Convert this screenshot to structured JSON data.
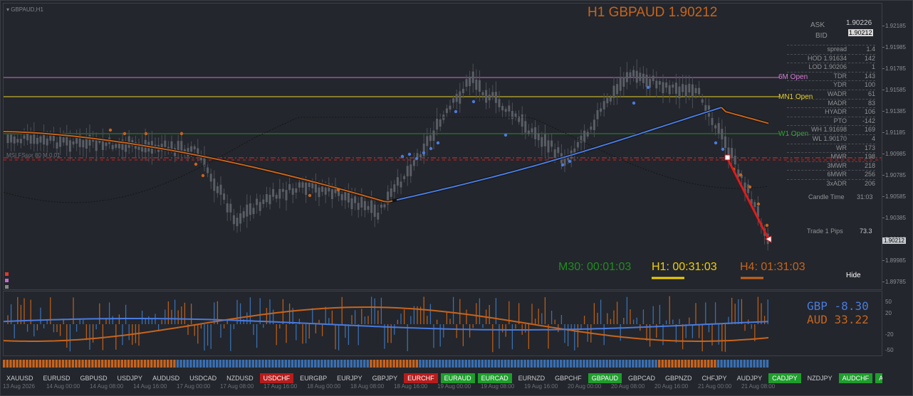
{
  "window": {
    "title": "GBPAUD,H1"
  },
  "chart": {
    "title": "H1 GBPAUD 1.90212",
    "ask_label": "ASK",
    "ask_value": "1.90226",
    "bid_label": "BID",
    "bid_value": "1.90212",
    "current_price_tag": "1.90212",
    "price_axis": [
      "1.92185",
      "1.91985",
      "1.91785",
      "1.91585",
      "1.91385",
      "1.91185",
      "1.90985",
      "1.90785",
      "1.90585",
      "1.90385",
      "1.90185",
      "1.89985",
      "1.89785"
    ],
    "levels": [
      {
        "label": "6M Open",
        "color": "#d77ad6"
      },
      {
        "label": "MN1 Open",
        "color": "#e8d12a"
      },
      {
        "label": "W1 Open",
        "color": "#2e9a2e"
      }
    ],
    "info_rows": [
      {
        "k": "spread",
        "v": "1.4"
      },
      {
        "k": "HOD 1.91634",
        "v": "142"
      },
      {
        "k": "LOD 1.90206",
        "v": "1"
      },
      {
        "k": "TDR",
        "v": "143"
      },
      {
        "k": "YDR",
        "v": "100"
      },
      {
        "k": "WADR",
        "v": "61"
      },
      {
        "k": "MADR",
        "v": "83"
      },
      {
        "k": "HYADR",
        "v": "106"
      },
      {
        "k": "PTO",
        "v": "-142"
      },
      {
        "k": "WH 1.91698",
        "v": "169"
      },
      {
        "k": "WL 1.90170",
        "v": "4"
      },
      {
        "k": "WR",
        "v": "173"
      },
      {
        "k": "MWR",
        "v": "198"
      },
      {
        "k": "3MWR",
        "v": "218"
      },
      {
        "k": "6MWR",
        "v": "256"
      },
      {
        "k": "3xADR",
        "v": "206"
      }
    ],
    "candle_time_label": "Candle Time",
    "candle_time_value": "31:03",
    "trade_label": "Trade 1 Pips",
    "trade_value": "73.3",
    "timers": [
      {
        "label": "M30: 00:01:03",
        "color": "#1f8d1f"
      },
      {
        "label": "H1: 00:31:03",
        "color": "#f2d000"
      },
      {
        "label": "H4: 01:31:03",
        "color": "#c8641c"
      }
    ],
    "hide_label": "Hide",
    "indicator_tag": "MSI FSsor 80 M 0.01"
  },
  "strength": {
    "axis": [
      "50",
      "20",
      "-20",
      "-50"
    ],
    "currencies": [
      {
        "name": "GBP",
        "value": "-8.30",
        "color": "#4a7be0"
      },
      {
        "name": "AUD",
        "value": "33.22",
        "color": "#c8641c"
      }
    ]
  },
  "pairs": [
    {
      "label": "XAUUSD",
      "state": "none"
    },
    {
      "label": "EURUSD",
      "state": "none"
    },
    {
      "label": "GBPUSD",
      "state": "none"
    },
    {
      "label": "USDJPY",
      "state": "none"
    },
    {
      "label": "AUDUSD",
      "state": "none"
    },
    {
      "label": "USDCAD",
      "state": "none"
    },
    {
      "label": "NZDUSD",
      "state": "none"
    },
    {
      "label": "USDCHF",
      "state": "red"
    },
    {
      "label": "EURGBP",
      "state": "none"
    },
    {
      "label": "EURJPY",
      "state": "none"
    },
    {
      "label": "GBPJPY",
      "state": "none"
    },
    {
      "label": "EURCHF",
      "state": "red"
    },
    {
      "label": "EURAUD",
      "state": "green"
    },
    {
      "label": "EURCAD",
      "state": "green"
    },
    {
      "label": "EURNZD",
      "state": "none"
    },
    {
      "label": "GBPCHF",
      "state": "none"
    },
    {
      "label": "GBPAUD",
      "state": "green"
    },
    {
      "label": "GBPCAD",
      "state": "none"
    },
    {
      "label": "GBPNZD",
      "state": "none"
    },
    {
      "label": "CHFJPY",
      "state": "none"
    },
    {
      "label": "AUDJPY",
      "state": "none"
    },
    {
      "label": "CADJPY",
      "state": "green"
    },
    {
      "label": "NZDJPY",
      "state": "none"
    },
    {
      "label": "AUDCHF",
      "state": "green"
    },
    {
      "label": "AUDC",
      "state": "green"
    }
  ],
  "time_axis": [
    "13 Aug 2026",
    "14 Aug 00:00",
    "14 Aug 08:00",
    "14 Aug 16:00",
    "17 Aug 00:00",
    "17 Aug 08:00",
    "17 Aug 16:00",
    "18 Aug 00:00",
    "18 Aug 08:00",
    "18 Aug 16:00",
    "19 Aug 00:00",
    "19 Aug 08:00",
    "19 Aug 16:00",
    "20 Aug 00:00",
    "20 Aug 08:00",
    "20 Aug 16:00",
    "21 Aug 00:00",
    "21 Aug 08:00"
  ]
}
